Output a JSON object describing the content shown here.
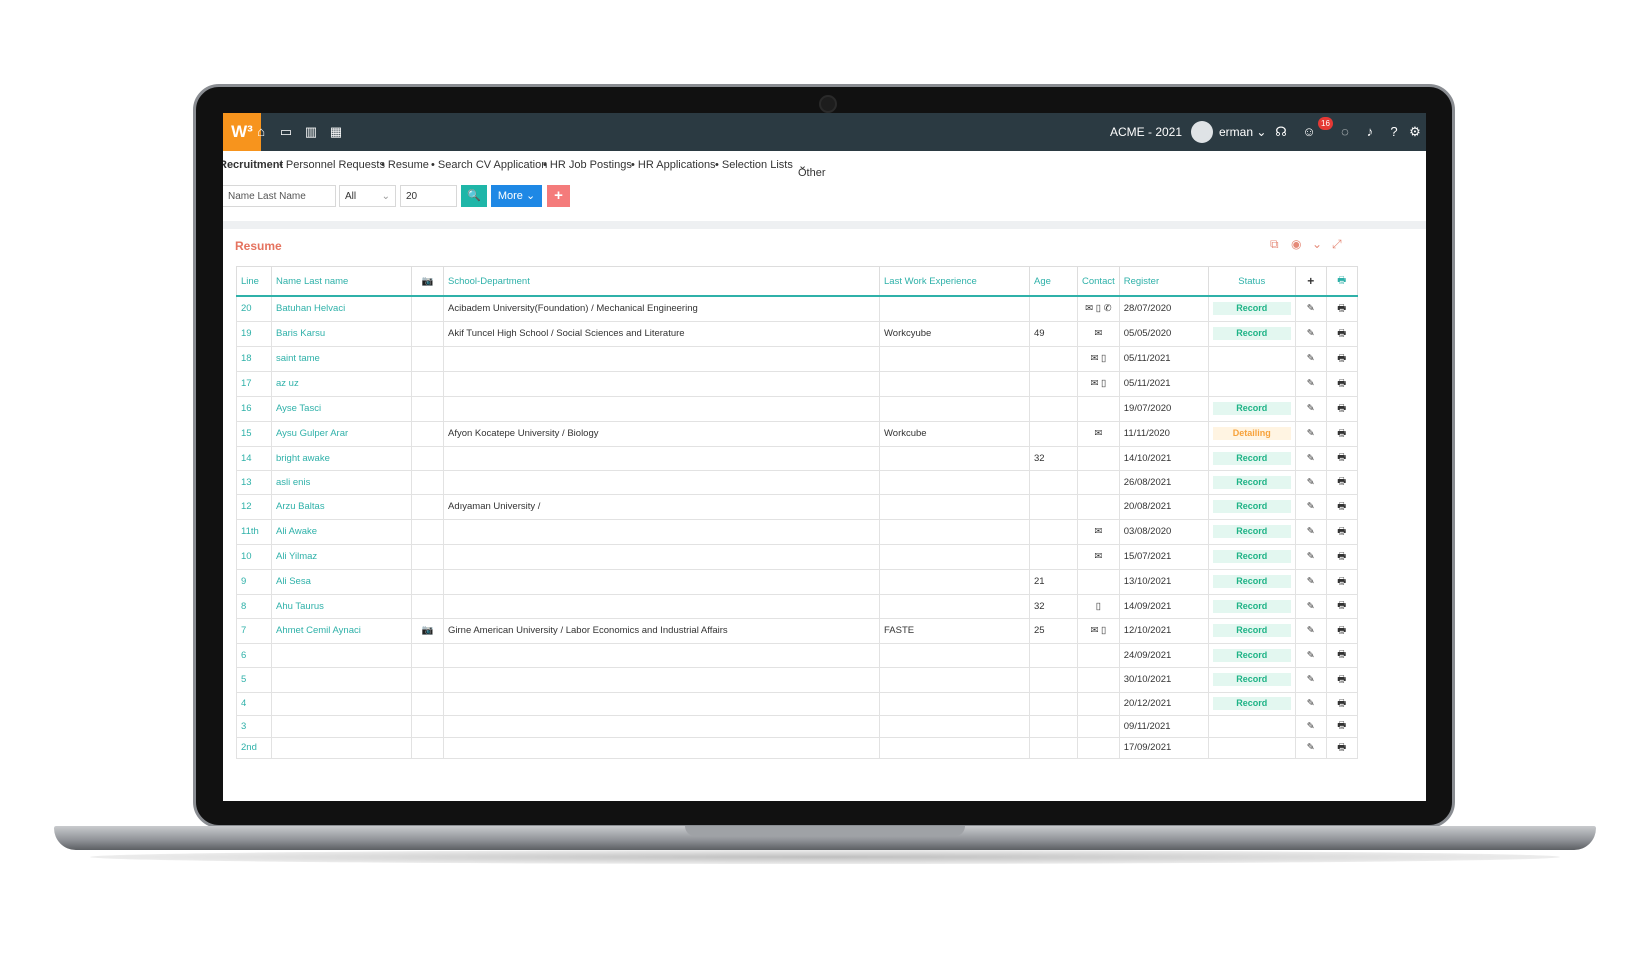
{
  "header": {
    "logo": "W³",
    "company": "ACME - 2021",
    "user": "erman",
    "notification_count": "16",
    "nav_icons": [
      "home-icon",
      "box-icon",
      "chart-icon",
      "calendar-icon"
    ],
    "right_icons": [
      "headset-icon",
      "smile-icon",
      "chat-icon",
      "bell-icon",
      "help-icon",
      "gear-icon"
    ]
  },
  "subnav": {
    "active": "Recruitment",
    "items": [
      "• Personnel Requests",
      "• Resume",
      "• Search CV Application",
      "• HR Job Postings",
      "• HR Applications",
      "• Selection Lists",
      "Other"
    ]
  },
  "filters": {
    "name_placeholder": "Name Last Name",
    "select_value": "All",
    "count_value": "20",
    "more_label": "More",
    "add_label": "+",
    "search_label": "🔍"
  },
  "panel": {
    "title": "Resume"
  },
  "table": {
    "columns": [
      "Line",
      "Name Last name",
      "📷",
      "School-Department",
      "Last Work Experience",
      "Age",
      "Contact",
      "Register",
      "Status",
      "+",
      "🖶"
    ],
    "rows": [
      [
        "20",
        "Batuhan Helvaci",
        "",
        "Acibadem University(Foundation) / Mechanical Engineering",
        "",
        "",
        "✉ ▯ ✆",
        "28/07/2020",
        "Record"
      ],
      [
        "19",
        "Baris Karsu",
        "",
        "Akif Tuncel High School / Social Sciences and Literature",
        "Workcyube",
        "49",
        "✉",
        "05/05/2020",
        "Record"
      ],
      [
        "18",
        "saint tame",
        "",
        "",
        "",
        "",
        "✉ ▯",
        "05/11/2021",
        ""
      ],
      [
        "17",
        "az uz",
        "",
        "",
        "",
        "",
        "✉ ▯",
        "05/11/2021",
        ""
      ],
      [
        "16",
        "Ayse Tasci",
        "",
        "",
        "",
        "",
        "",
        "19/07/2020",
        "Record"
      ],
      [
        "15",
        "Aysu Gulper Arar",
        "",
        "Afyon Kocatepe University / Biology",
        "Workcube",
        "",
        "✉",
        "11/11/2020",
        "Detailing"
      ],
      [
        "14",
        "bright awake",
        "",
        "",
        "",
        "32",
        "",
        "14/10/2021",
        "Record"
      ],
      [
        "13",
        "asli enis",
        "",
        "",
        "",
        "",
        "",
        "26/08/2021",
        "Record"
      ],
      [
        "12",
        "Arzu Baltas",
        "",
        "Adıyaman University /",
        "",
        "",
        "",
        "20/08/2021",
        "Record"
      ],
      [
        "11th",
        "Ali Awake",
        "",
        "",
        "",
        "",
        "✉",
        "03/08/2020",
        "Record"
      ],
      [
        "10",
        "Ali Yilmaz",
        "",
        "",
        "",
        "",
        "✉",
        "15/07/2021",
        "Record"
      ],
      [
        "9",
        "Ali Sesa",
        "",
        "",
        "",
        "21",
        "",
        "13/10/2021",
        "Record"
      ],
      [
        "8",
        "Ahu Taurus",
        "",
        "",
        "",
        "32",
        "▯",
        "14/09/2021",
        "Record"
      ],
      [
        "7",
        "Ahmet Cemil Aynaci",
        "📷",
        "Girne American University / Labor Economics and Industrial Affairs",
        "FASTE",
        "25",
        "✉ ▯",
        "12/10/2021",
        "Record"
      ],
      [
        "6",
        "",
        "",
        "",
        "",
        "",
        "",
        "24/09/2021",
        "Record"
      ],
      [
        "5",
        "",
        "",
        "",
        "",
        "",
        "",
        "30/10/2021",
        "Record"
      ],
      [
        "4",
        "",
        "",
        "",
        "",
        "",
        "",
        "20/12/2021",
        "Record"
      ],
      [
        "3",
        "",
        "",
        "",
        "",
        "",
        "",
        "09/11/2021",
        ""
      ],
      [
        "2nd",
        "",
        "",
        "",
        "",
        "",
        "",
        "17/09/2021",
        ""
      ]
    ],
    "edit_icon": "✎",
    "print_icon": "🖶"
  },
  "colors": {
    "accent_teal": "#2fb1a9",
    "logo_orange": "#f7941d",
    "topbar": "#2b3a42",
    "title_salmon": "#e5735f",
    "record_green": "#1eb386",
    "detailing_orange": "#f7a23b"
  }
}
